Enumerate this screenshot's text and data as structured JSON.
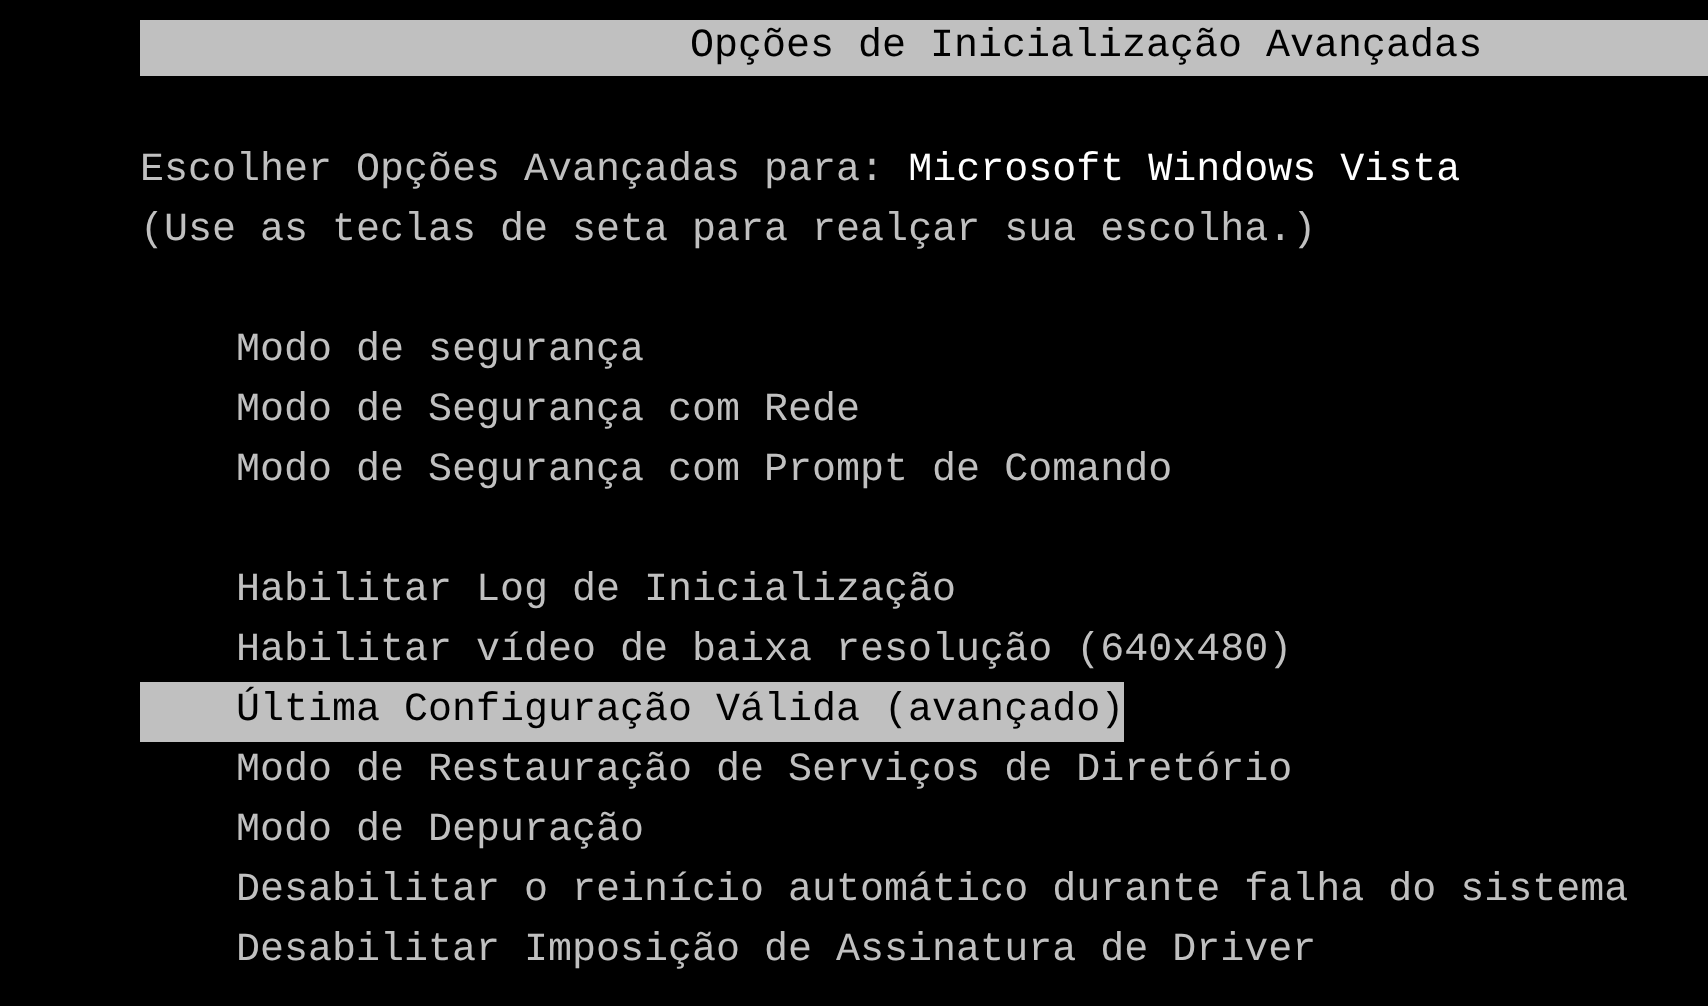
{
  "title": "Opções de Inicialização Avançadas",
  "prompt": {
    "label": "Escolher Opções Avançadas para:",
    "os_name": "Microsoft Windows Vista"
  },
  "hint": "(Use as teclas de seta para realçar sua escolha.)",
  "groups": [
    {
      "items": [
        {
          "label": "Modo de segurança",
          "selected": false
        },
        {
          "label": "Modo de Segurança com Rede",
          "selected": false
        },
        {
          "label": "Modo de Segurança com Prompt de Comando",
          "selected": false
        }
      ]
    },
    {
      "items": [
        {
          "label": "Habilitar Log de Inicialização",
          "selected": false
        },
        {
          "label": "Habilitar vídeo de baixa resolução (640x480)",
          "selected": false
        },
        {
          "label": "Última Configuração Válida (avançado)",
          "selected": true
        },
        {
          "label": "Modo de Restauração de Serviços de Diretório",
          "selected": false
        },
        {
          "label": "Modo de Depuração",
          "selected": false
        },
        {
          "label": "Desabilitar o reinício automático durante falha do sistema",
          "selected": false
        },
        {
          "label": "Desabilitar Imposição de Assinatura de Driver",
          "selected": false
        }
      ]
    }
  ]
}
